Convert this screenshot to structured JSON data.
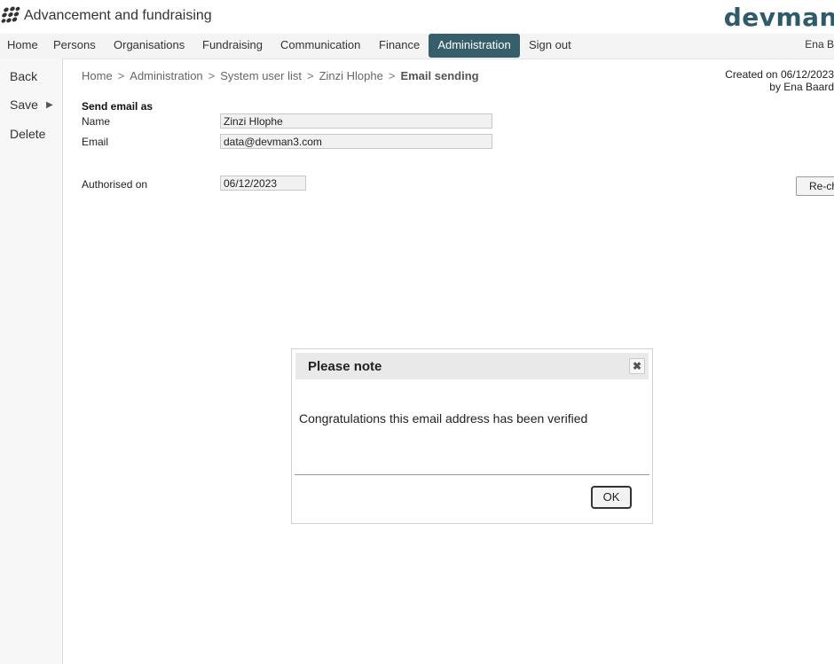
{
  "app": {
    "title": "Advancement and fundraising",
    "brand": "devman",
    "user": "Ena B"
  },
  "nav": {
    "items": [
      {
        "label": "Home"
      },
      {
        "label": "Persons"
      },
      {
        "label": "Organisations"
      },
      {
        "label": "Fundraising"
      },
      {
        "label": "Communication"
      },
      {
        "label": "Finance"
      },
      {
        "label": "Administration",
        "active": true
      },
      {
        "label": "Sign out"
      }
    ]
  },
  "sidebar": {
    "back": "Back",
    "save": "Save",
    "save_arrow": "▶",
    "delete": "Delete"
  },
  "breadcrumb": {
    "items": [
      "Home",
      "Administration",
      "System user list",
      "Zinzi Hlophe"
    ],
    "separator": ">",
    "current": "Email sending"
  },
  "meta": {
    "created_line": "Created on 06/12/2023",
    "by_line": "by Ena Baard"
  },
  "form": {
    "section_title": "Send email as",
    "name_label": "Name",
    "name_value": "Zinzi Hlophe",
    "email_label": "Email",
    "email_value": "data@devman3.com",
    "authorised_label": "Authorised on",
    "authorised_value": "06/12/2023",
    "recheck_label": "Re-check"
  },
  "dialog": {
    "title": "Please note",
    "close_glyph": "✖",
    "message": "Congratulations this email address has been verified",
    "ok_label": "OK"
  },
  "colors": {
    "accent": "#365e6b",
    "brand": "#2e5a69"
  }
}
